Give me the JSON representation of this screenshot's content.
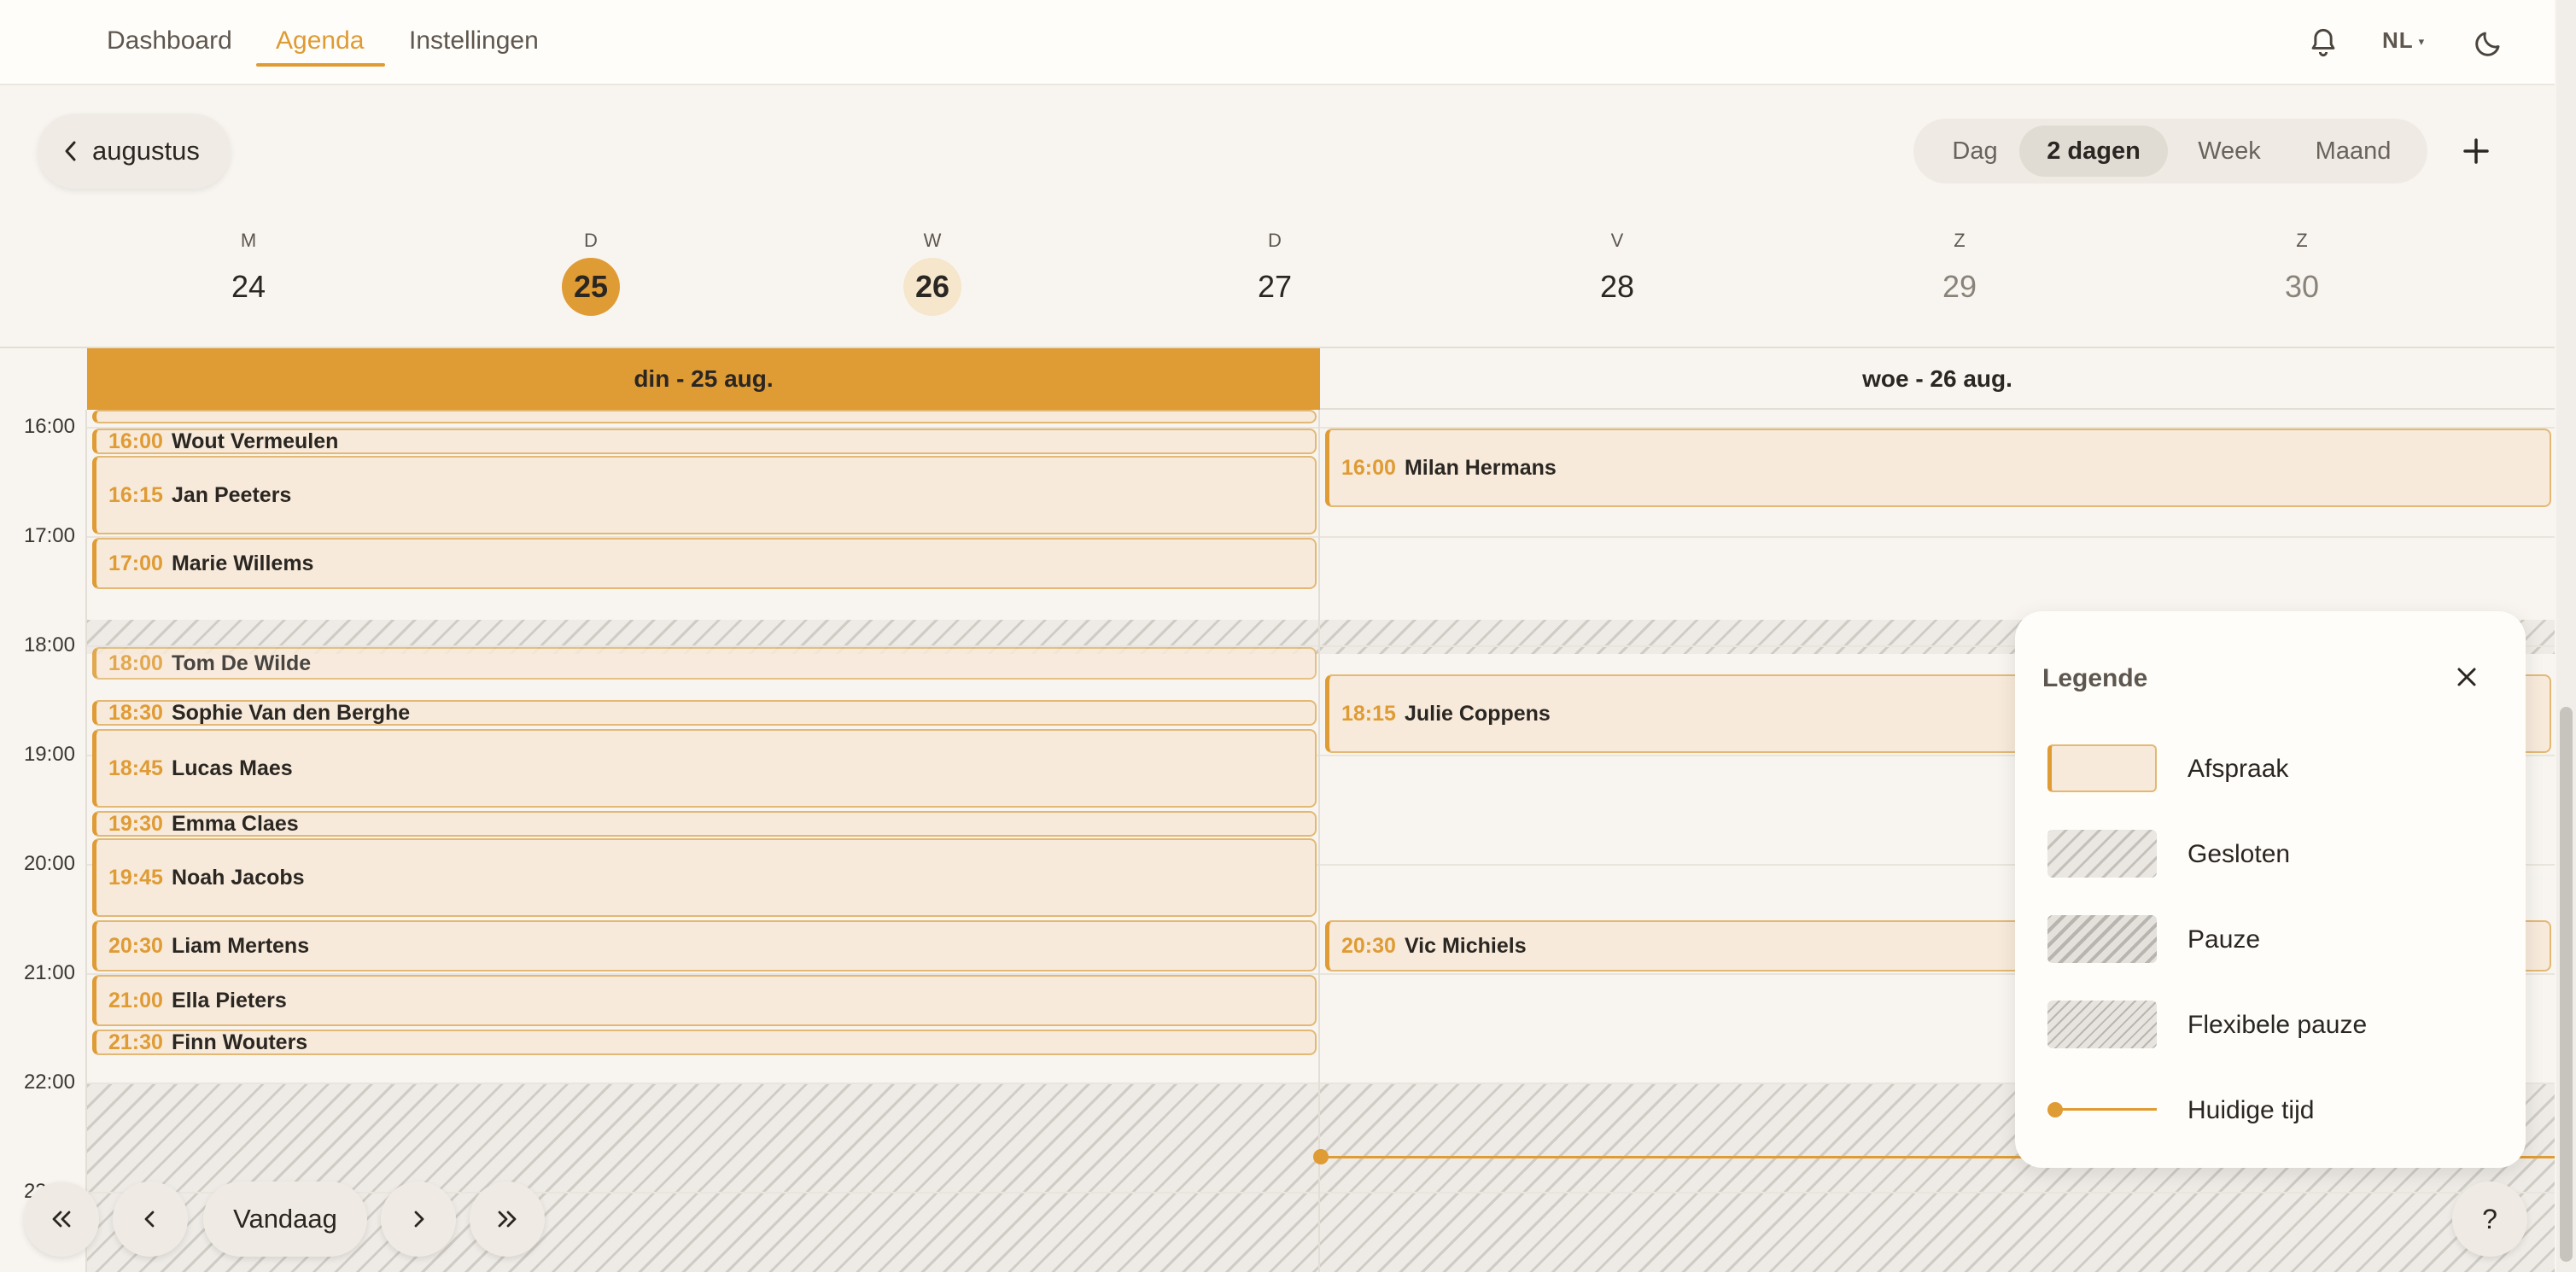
{
  "nav": {
    "tabs": [
      {
        "label": "Dashboard"
      },
      {
        "label": "Agenda"
      },
      {
        "label": "Instellingen"
      }
    ],
    "active_tab": "Agenda",
    "language": "NL",
    "icons": [
      "bell-icon",
      "moon-icon"
    ]
  },
  "toolbar": {
    "month_label": "augustus",
    "views": [
      "Dag",
      "2 dagen",
      "Week",
      "Maand"
    ],
    "active_view": "2 dagen",
    "add_icon": "plus-icon"
  },
  "week": {
    "days": [
      {
        "letter": "M",
        "number": "24"
      },
      {
        "letter": "D",
        "number": "25"
      },
      {
        "letter": "W",
        "number": "26"
      },
      {
        "letter": "D",
        "number": "27"
      },
      {
        "letter": "V",
        "number": "28"
      },
      {
        "letter": "Z",
        "number": "29"
      },
      {
        "letter": "Z",
        "number": "30"
      }
    ],
    "today": "25",
    "selected": "26"
  },
  "calendar": {
    "columns": [
      {
        "label": "din - 25 aug."
      },
      {
        "label": "woe - 26 aug."
      }
    ],
    "hours": [
      "16:00",
      "17:00",
      "18:00",
      "19:00",
      "20:00",
      "21:00",
      "22:00",
      "23:00"
    ],
    "appointments_day1": [
      {
        "time": "16:00",
        "name": "Wout Vermeulen"
      },
      {
        "time": "16:15",
        "name": "Jan Peeters"
      },
      {
        "time": "17:00",
        "name": "Marie Willems"
      },
      {
        "time": "18:00",
        "name": "Tom De Wilde"
      },
      {
        "time": "18:30",
        "name": "Sophie Van den Berghe"
      },
      {
        "time": "18:45",
        "name": "Lucas Maes"
      },
      {
        "time": "19:30",
        "name": "Emma Claes"
      },
      {
        "time": "19:45",
        "name": "Noah Jacobs"
      },
      {
        "time": "20:30",
        "name": "Liam Mertens"
      },
      {
        "time": "21:00",
        "name": "Ella Pieters"
      },
      {
        "time": "21:30",
        "name": "Finn Wouters"
      }
    ],
    "appointments_day2": [
      {
        "time": "16:00",
        "name": "Milan Hermans"
      },
      {
        "time": "18:15",
        "name": "Julie Coppens"
      },
      {
        "time": "20:30",
        "name": "Vic Michiels"
      }
    ]
  },
  "legend": {
    "title": "Legende",
    "items": [
      {
        "label": "Afspraak"
      },
      {
        "label": "Gesloten"
      },
      {
        "label": "Pauze"
      },
      {
        "label": "Flexibele pauze"
      },
      {
        "label": "Huidige tijd"
      }
    ]
  },
  "footer": {
    "today_label": "Vandaag",
    "help_label": "?"
  },
  "colors": {
    "accent": "#df9b34",
    "appointment_bg": "#f8eada",
    "background": "#f8f5f0"
  }
}
